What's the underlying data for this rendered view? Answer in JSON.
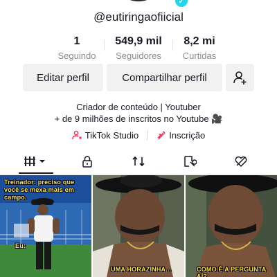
{
  "profile": {
    "username": "@eutiringaofiicial",
    "stats": [
      {
        "value": "1",
        "label": "Seguindo"
      },
      {
        "value": "549,9 mil",
        "label": "Seguidores"
      },
      {
        "value": "8,2 mi",
        "label": "Curtidas"
      }
    ],
    "bio_line1": "Criador de conteúdo | Youtuber",
    "bio_line2": "+ de 9 milhões de inscritos no Youtube",
    "bio_emoji": "🎥"
  },
  "buttons": {
    "edit": "Editar perfil",
    "share": "Compartilhar perfil"
  },
  "links": {
    "studio": "TikTok Studio",
    "subscription": "Inscrição"
  },
  "videos": [
    {
      "caption_top": "Treinador: preciso que você se mexa mais em campo.",
      "caption_bottom": "Eu:"
    },
    {
      "caption_bottom": "UMA HORAZINHA..."
    },
    {
      "caption_bottom": "COMO É A PERGUNTA AÍ?"
    }
  ],
  "colors": {
    "verify": "#20d5ec",
    "studio_icon": "#fe2c55",
    "caption": "#ffe34a"
  }
}
